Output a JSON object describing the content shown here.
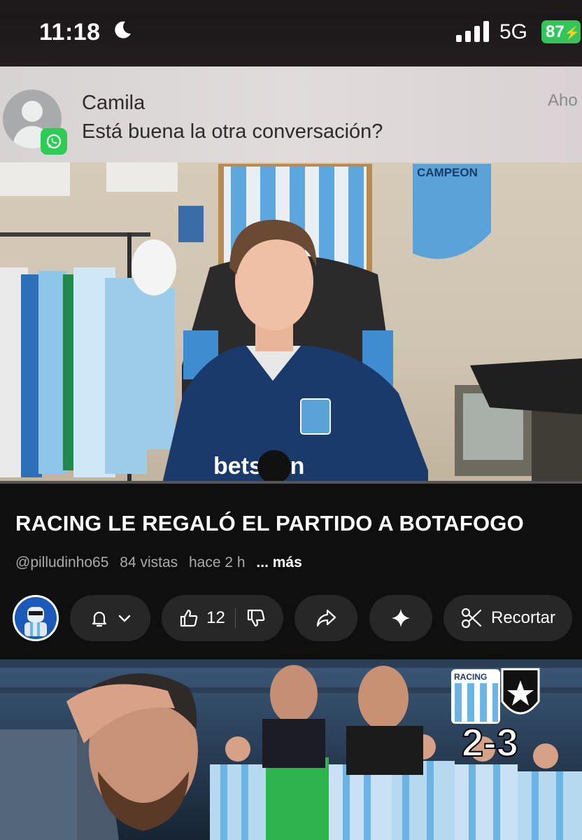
{
  "status": {
    "time": "11:18",
    "network": "5G",
    "battery": "87",
    "battery_color": "#32c65a"
  },
  "notification": {
    "sender": "Camila",
    "message": "Está buena la otra conversación?",
    "time": "Aho",
    "app_icon": "whatsapp-icon"
  },
  "video": {
    "title": "RACING LE REGALÓ EL PARTIDO A BOTAFOGO",
    "channel": "@pilludinho65",
    "views": "84 vistas",
    "age": "hace 2 h",
    "more": "... más",
    "progress": 0.0
  },
  "actions": {
    "likes": "12",
    "clip_label": "Recortar",
    "icons": [
      "bell-icon",
      "chevron-down-icon",
      "thumbs-up-icon",
      "thumbs-down-icon",
      "share-icon",
      "sparkle-icon",
      "scissors-icon"
    ]
  },
  "next_thumbnail": {
    "score": "2-3",
    "crest_text": "RACING"
  },
  "colors": {
    "background": "#0f0f0f",
    "pill": "#272727",
    "racing_blue": "#6cb4e4"
  }
}
